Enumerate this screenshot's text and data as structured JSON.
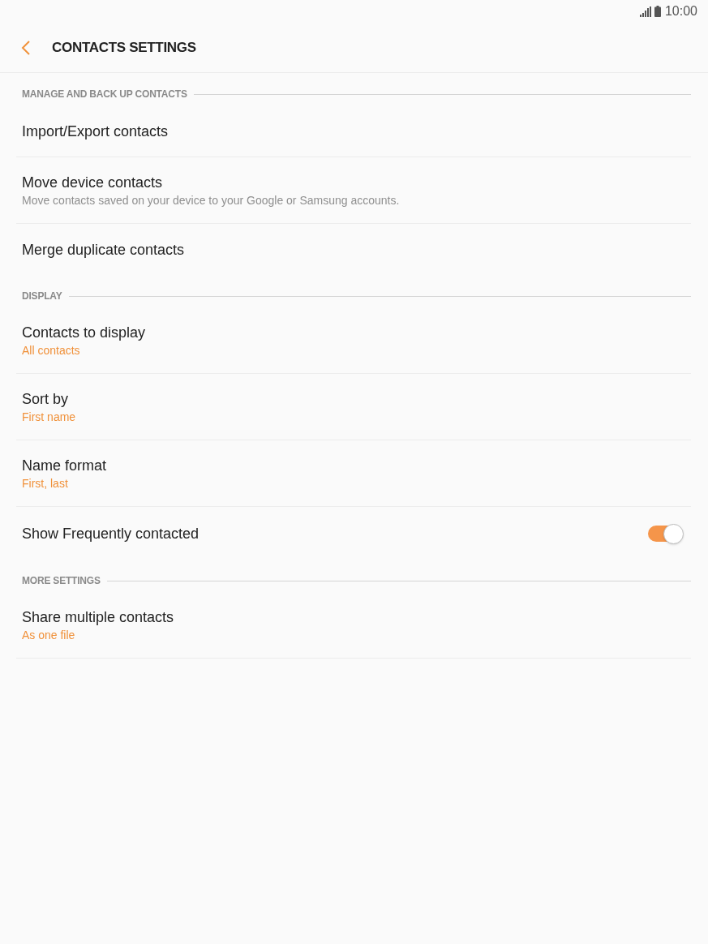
{
  "status_bar": {
    "time": "10:00"
  },
  "header": {
    "title": "CONTACTS SETTINGS"
  },
  "sections": [
    {
      "title": "MANAGE AND BACK UP CONTACTS",
      "items": [
        {
          "kind": "link",
          "title": "Import/Export contacts"
        },
        {
          "kind": "link",
          "title": "Move device contacts",
          "description": "Move contacts saved on your device to your Google or Samsung accounts."
        },
        {
          "kind": "link",
          "title": "Merge duplicate contacts"
        }
      ]
    },
    {
      "title": "DISPLAY",
      "items": [
        {
          "kind": "value",
          "title": "Contacts to display",
          "value": "All contacts"
        },
        {
          "kind": "value",
          "title": "Sort by",
          "value": "First name"
        },
        {
          "kind": "value",
          "title": "Name format",
          "value": "First, last"
        },
        {
          "kind": "toggle",
          "title": "Show Frequently contacted",
          "on": true
        }
      ]
    },
    {
      "title": "MORE SETTINGS",
      "items": [
        {
          "kind": "value",
          "title": "Share multiple contacts",
          "value": "As one file"
        }
      ]
    }
  ]
}
